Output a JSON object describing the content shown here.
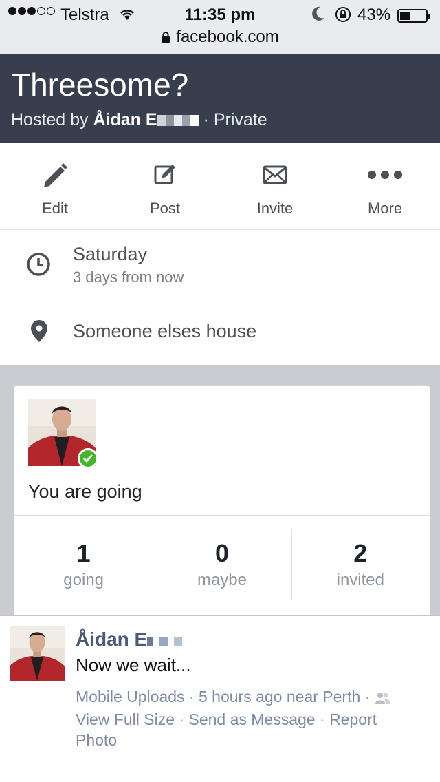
{
  "status_bar": {
    "carrier": "Telstra",
    "time": "11:35 pm",
    "battery": "43%",
    "battery_level": 0.43,
    "url": "facebook.com"
  },
  "event": {
    "title": "Threesome?",
    "hosted_by_prefix": "Hosted by",
    "host_name": "Åidan E",
    "privacy": "Private"
  },
  "actions": [
    {
      "label": "Edit",
      "icon": "pencil-icon"
    },
    {
      "label": "Post",
      "icon": "compose-icon"
    },
    {
      "label": "Invite",
      "icon": "envelope-icon"
    },
    {
      "label": "More",
      "icon": "more-dots-icon"
    }
  ],
  "details": {
    "day": "Saturday",
    "relative": "3 days from now",
    "location": "Someone elses house"
  },
  "rsvp": {
    "status_text": "You are going",
    "stats": [
      {
        "count": "1",
        "label": "going"
      },
      {
        "count": "0",
        "label": "maybe"
      },
      {
        "count": "2",
        "label": "invited"
      }
    ]
  },
  "photo_caption": {
    "author": "Åidan E",
    "text": "Now we wait...",
    "album": "Mobile Uploads",
    "time": "5 hours ago",
    "near_prefix": "near",
    "place": "Perth",
    "view_full_size": "View Full Size",
    "send_as_message": "Send as Message",
    "report": "Report",
    "photo": "Photo"
  },
  "colors": {
    "header_bg": "#373e4d",
    "check_green": "#42b72a",
    "link_gray_blue": "#7d8aa8"
  }
}
